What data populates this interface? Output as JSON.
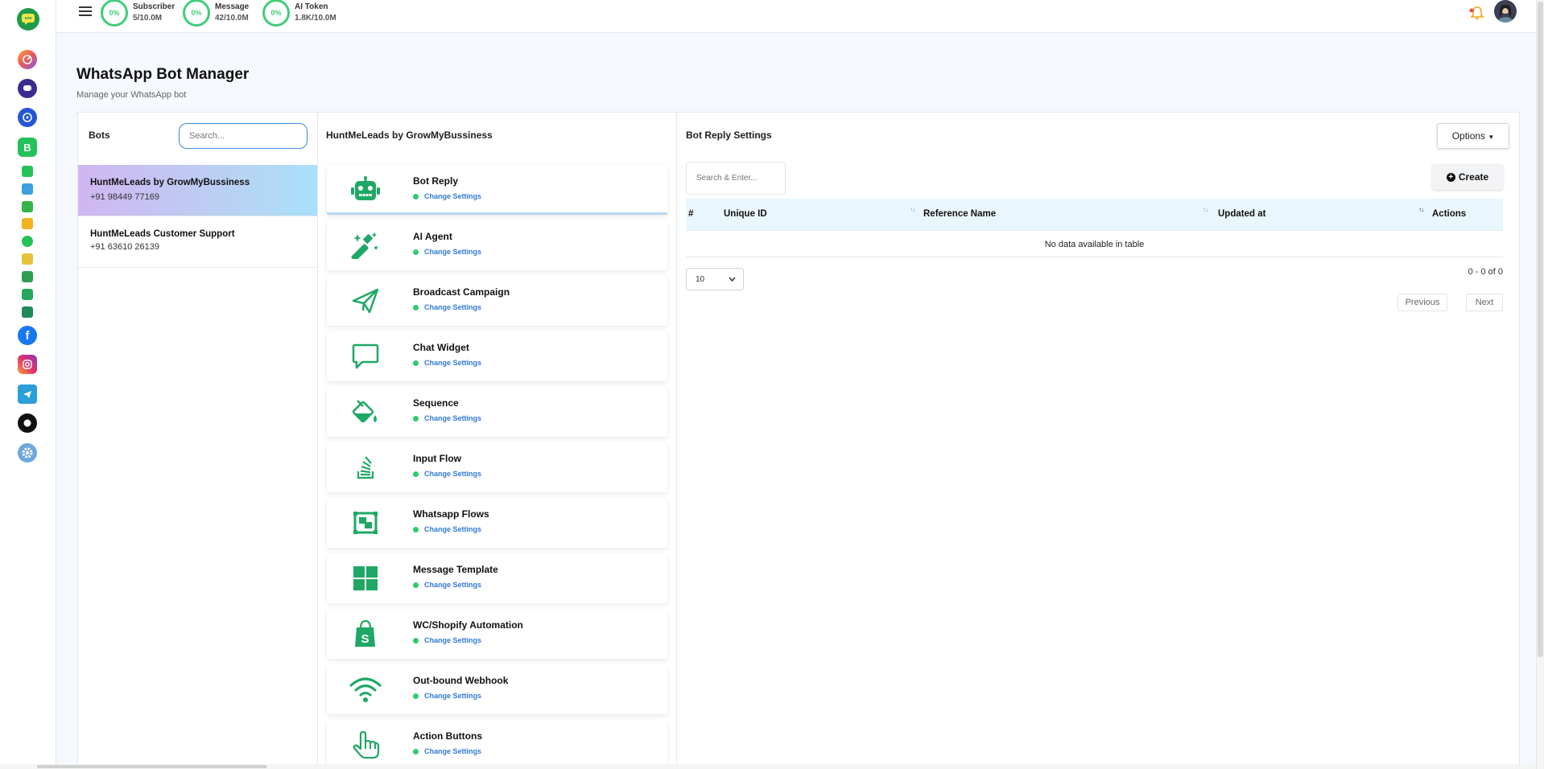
{
  "topbar": {
    "stats": [
      {
        "percent": "0%",
        "label": "Subscriber",
        "value": "5/10.0M"
      },
      {
        "percent": "0%",
        "label": "Message",
        "value": "42/10.0M"
      },
      {
        "percent": "0%",
        "label": "AI Token",
        "value": "1.8K/10.0M"
      }
    ],
    "accent_color": "#3fce77",
    "notification_color": "#f5a623"
  },
  "sidebar": {
    "icons": [
      "chat-logo-icon",
      "dashboard-icon",
      "livechat-icon",
      "analytics-icon",
      "whatsapp-business-icon",
      "whatsapp-small-icon",
      "robot-small-icon",
      "spreadsheet-icon",
      "leaf-icon",
      "whatsapp-outline-icon",
      "folder-icon",
      "document-icon",
      "shop-bag-icon",
      "chart-icon",
      "facebook-icon",
      "instagram-icon",
      "telegram-icon",
      "messenger-icon",
      "settings-icon"
    ]
  },
  "page": {
    "title": "WhatsApp Bot Manager",
    "subtitle": "Manage your WhatsApp bot"
  },
  "bots": {
    "heading": "Bots",
    "search_placeholder": "Search...",
    "items": [
      {
        "name": "HuntMeLeads by GrowMyBussiness",
        "phone": "+91 98449 77169"
      },
      {
        "name": "HuntMeLeads Customer Support",
        "phone": "+91 63610 26139"
      }
    ]
  },
  "middle": {
    "heading": "HuntMeLeads by GrowMyBussiness",
    "features": [
      {
        "name": "Bot Reply",
        "link": "Change Settings",
        "icon": "robot-icon"
      },
      {
        "name": "AI Agent",
        "link": "Change Settings",
        "icon": "magic-wand-icon"
      },
      {
        "name": "Broadcast Campaign",
        "link": "Change Settings",
        "icon": "paper-plane-icon"
      },
      {
        "name": "Chat Widget",
        "link": "Change Settings",
        "icon": "chat-bubble-icon"
      },
      {
        "name": "Sequence",
        "link": "Change Settings",
        "icon": "paint-bucket-icon"
      },
      {
        "name": "Input Flow",
        "link": "Change Settings",
        "icon": "stack-icon"
      },
      {
        "name": "Whatsapp Flows",
        "link": "Change Settings",
        "icon": "flows-frame-icon"
      },
      {
        "name": "Message Template",
        "link": "Change Settings",
        "icon": "grid-icon"
      },
      {
        "name": "WC/Shopify Automation",
        "link": "Change Settings",
        "icon": "shopify-bag-icon"
      },
      {
        "name": "Out-bound Webhook",
        "link": "Change Settings",
        "icon": "wifi-icon"
      },
      {
        "name": "Action Buttons",
        "link": "Change Settings",
        "icon": "hand-pointer-icon"
      }
    ]
  },
  "right": {
    "heading": "Bot Reply Settings",
    "options_label": "Options",
    "search_placeholder": "Search & Enter...",
    "create_label": "Create",
    "columns": [
      "#",
      "Unique ID",
      "Reference Name",
      "Updated at",
      "Actions"
    ],
    "empty_text": "No data available in table",
    "page_size": "10",
    "count_text": "0 - 0 of 0",
    "prev_label": "Previous",
    "next_label": "Next"
  }
}
